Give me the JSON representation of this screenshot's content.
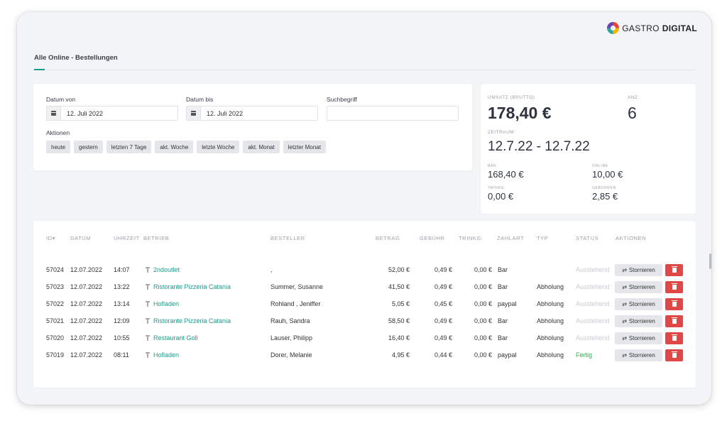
{
  "brand": {
    "part1": "GASTRO",
    "part2": "DIGITAL"
  },
  "tab": {
    "label": "Alle Online - Bestellungen"
  },
  "filters": {
    "date_from_label": "Datum von",
    "date_from_value": "12. Juli 2022",
    "date_to_label": "Datum bis",
    "date_to_value": "12. Juli 2022",
    "search_label": "Suchbegriff",
    "search_value": "",
    "actions_label": "Aktionen",
    "actions": [
      "heute",
      "gestern",
      "letzten 7 Tage",
      "akt. Woche",
      "letzte Woche",
      "akt. Monat",
      "letzter Monat"
    ]
  },
  "stats": {
    "umsatz_label": "UMSATZ (BRUTTO)",
    "umsatz_value": "178,40 €",
    "anz_label": "ANZ.",
    "anz_value": "6",
    "zeitraum_label": "ZEITRAUM",
    "zeitraum_value": "12.7.22 - 12.7.22",
    "bar_label": "BAR",
    "bar_value": "168,40 €",
    "online_label": "ONLINE",
    "online_value": "10,00 €",
    "trinkg_label": "TRINKG.",
    "trinkg_value": "0,00 €",
    "gebuehren_label": "GEBÜHREN",
    "gebuehren_value": "2,85 €"
  },
  "table": {
    "headers": [
      "ID▾",
      "DATUM",
      "UHRZEIT",
      "BETRIEB",
      "BESTELLER",
      "BETRAG",
      "GEBÜHR",
      "TRINKG.",
      "ZAHLART",
      "TYP",
      "STATUS",
      "AKTIONEN"
    ],
    "cancel_label": "Stornieren",
    "rows": [
      {
        "id": "57024",
        "date": "12.07.2022",
        "time": "14:07",
        "business": "2ndoutlet",
        "customer": ",",
        "amount": "52,00 €",
        "fee": "0,49 €",
        "tip": "0,00 €",
        "payment": "Bar",
        "type": "",
        "status": "Ausstehend"
      },
      {
        "id": "57023",
        "date": "12.07.2022",
        "time": "13:22",
        "business": "Ristorante Pizzeria Catania",
        "customer": "Summer, Susanne",
        "amount": "41,50 €",
        "fee": "0,49 €",
        "tip": "0,00 €",
        "payment": "Bar",
        "type": "Abholung",
        "status": "Ausstehend"
      },
      {
        "id": "57022",
        "date": "12.07.2022",
        "time": "13:14",
        "business": "Hofladen",
        "customer": "Rohland , Jeniffer",
        "amount": "5,05 €",
        "fee": "0,45 €",
        "tip": "0,00 €",
        "payment": "paypal",
        "type": "Abholung",
        "status": "Ausstehend"
      },
      {
        "id": "57021",
        "date": "12.07.2022",
        "time": "12:09",
        "business": "Ristorante Pizzeria Catania",
        "customer": "Rauh, Sandra",
        "amount": "58,50 €",
        "fee": "0,49 €",
        "tip": "0,00 €",
        "payment": "Bar",
        "type": "Abholung",
        "status": "Ausstehend"
      },
      {
        "id": "57020",
        "date": "12.07.2022",
        "time": "10:55",
        "business": "Restaurant Goll",
        "customer": "Lauser, Philipp",
        "amount": "16,40 €",
        "fee": "0,49 €",
        "tip": "0,00 €",
        "payment": "Bar",
        "type": "Abholung",
        "status": "Ausstehend"
      },
      {
        "id": "57019",
        "date": "12.07.2022",
        "time": "08:11",
        "business": "Hofladen",
        "customer": "Dorer, Melanie",
        "amount": "4,95 €",
        "fee": "0,44 €",
        "tip": "0,00 €",
        "payment": "paypal",
        "type": "Abholung",
        "status": "Fertig"
      }
    ]
  },
  "colors": {
    "accent": "#1a9e8b",
    "danger": "#e04848",
    "done": "#32b24a",
    "pending": "#c9ccd1"
  }
}
